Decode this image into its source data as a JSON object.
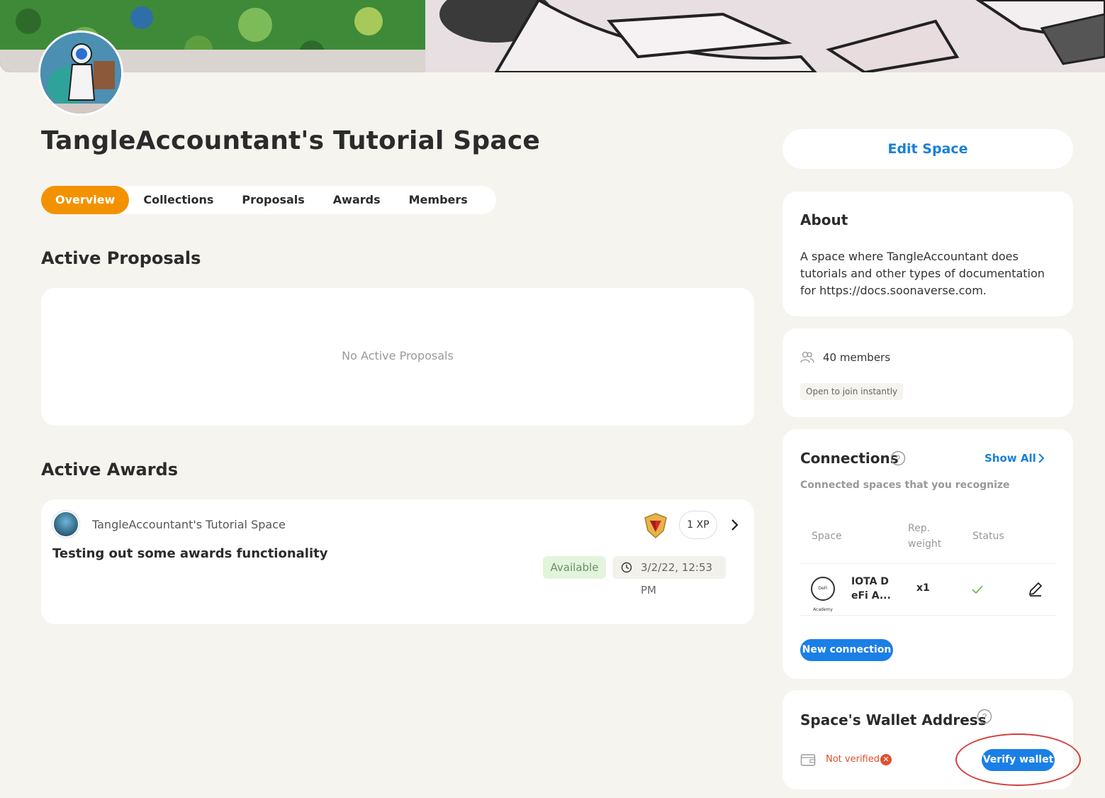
{
  "space": {
    "title": "TangleAccountant's Tutorial Space"
  },
  "tabs": [
    {
      "label": "Overview",
      "active": true
    },
    {
      "label": "Collections",
      "active": false
    },
    {
      "label": "Proposals",
      "active": false
    },
    {
      "label": "Awards",
      "active": false
    },
    {
      "label": "Members",
      "active": false
    }
  ],
  "proposals": {
    "heading": "Active Proposals",
    "empty_text": "No Active Proposals"
  },
  "awards": {
    "heading": "Active Awards",
    "items": [
      {
        "space_name": "TangleAccountant's Tutorial Space",
        "title": "Testing out some awards functionality",
        "xp": "1 XP",
        "status": "Available",
        "date": "3/2/22, 12:53 PM",
        "badge_icon": "ruby-shield-badge-icon"
      }
    ]
  },
  "sidebar": {
    "edit_label": "Edit Space",
    "about": {
      "heading": "About",
      "text": "A space where TangleAccountant does tutorials and other types of documentation for https://docs.soonaverse.com."
    },
    "members": {
      "count_label": "40 members",
      "join_label": "Open to join instantly"
    },
    "connections": {
      "heading": "Connections",
      "show_all": "Show All",
      "subtitle": "Connected spaces that you recognize",
      "columns": {
        "space": "Space",
        "rep_weight_1": "Rep.",
        "rep_weight_2": "weight",
        "status": "Status"
      },
      "rows": [
        {
          "name_line1": "IOTA D",
          "name_line2": "eFi A...",
          "logo_text": "DeFi Academy",
          "weight": "x1",
          "status": "verified"
        }
      ],
      "new_button": "New connection"
    },
    "wallet": {
      "heading": "Space's Wallet Address",
      "status": "Not verified",
      "verify_button": "Verify wallet"
    }
  },
  "colors": {
    "accent": "#f39200",
    "link": "#1a7fd6",
    "button": "#1a7fe6",
    "error": "#e0502e",
    "success": "#6cc04a"
  }
}
